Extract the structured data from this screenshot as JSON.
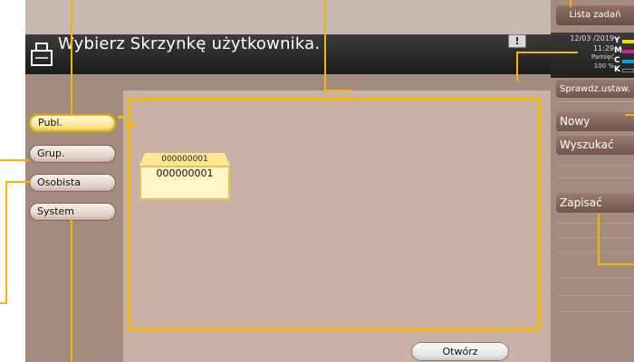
{
  "header": {
    "title": "Wybierz Skrzynkę użytkownika.",
    "warning_icon": "!"
  },
  "status": {
    "date": "12/03 /2019",
    "time": "11:29",
    "memory_label": "Pamięć",
    "memory_percent": "100 %",
    "toner": [
      {
        "letter": "Y",
        "color": "#f6d800"
      },
      {
        "letter": "M",
        "color": "#e0199b"
      },
      {
        "letter": "C",
        "color": "#00a2e0"
      },
      {
        "letter": "K",
        "color": "#1a1a1a"
      }
    ]
  },
  "right_panel": {
    "job_list": "Lista zadań",
    "check_settings": "Sprawdz.ustaw.",
    "new": "Nowy",
    "search": "Wyszukać",
    "save": "Zapisać"
  },
  "left_nav": {
    "items": [
      {
        "label": "Publ.",
        "active": true
      },
      {
        "label": "Grup.",
        "active": false
      },
      {
        "label": "Osobista",
        "active": false
      },
      {
        "label": "System",
        "active": false
      }
    ]
  },
  "boxes": [
    {
      "tab_label": "000000001",
      "name": "000000001"
    }
  ],
  "actions": {
    "open": "Otwórz"
  },
  "colors": {
    "frame": "#a38b7d",
    "content": "#c9b1a5",
    "highlight": "#f6b600"
  }
}
